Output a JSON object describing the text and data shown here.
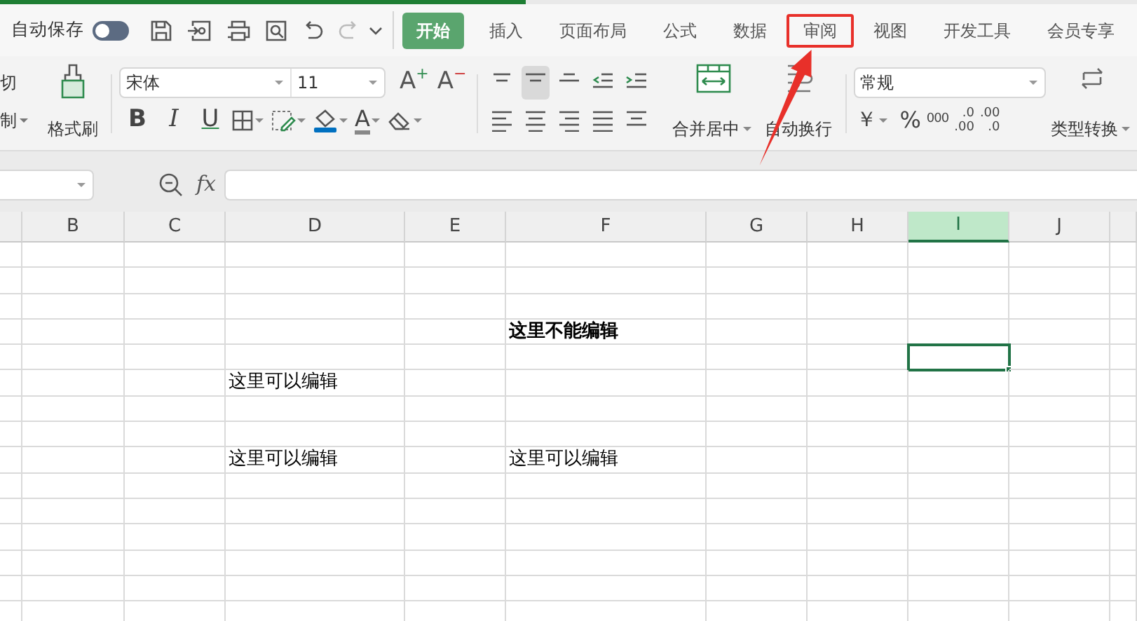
{
  "quick_access": {
    "autosave_label": "自动保存",
    "autosave_on": false
  },
  "tabs": [
    {
      "label": "开始",
      "selected": true,
      "highlighted": false
    },
    {
      "label": "插入",
      "selected": false,
      "highlighted": false
    },
    {
      "label": "页面布局",
      "selected": false,
      "highlighted": false
    },
    {
      "label": "公式",
      "selected": false,
      "highlighted": false
    },
    {
      "label": "数据",
      "selected": false,
      "highlighted": false
    },
    {
      "label": "审阅",
      "selected": false,
      "highlighted": true
    },
    {
      "label": "视图",
      "selected": false,
      "highlighted": false
    },
    {
      "label": "开发工具",
      "selected": false,
      "highlighted": false
    },
    {
      "label": "会员专享",
      "selected": false,
      "highlighted": false
    }
  ],
  "annotation": {
    "arrow": true
  },
  "ribbon": {
    "cut_label": "切",
    "copy_label": "制",
    "format_painter_label": "格式刷",
    "font_name": "宋体",
    "font_size": "11",
    "size_buttons": [
      {
        "letter": "A",
        "sign": "+"
      },
      {
        "letter": "A",
        "sign": "−"
      }
    ],
    "style_buttons": [
      {
        "kind": "bold",
        "label": "B"
      },
      {
        "kind": "italic",
        "label": "I"
      },
      {
        "kind": "underline",
        "label": "U"
      }
    ],
    "font_color_letter": "A",
    "merge_label": "合并居中",
    "wrap_label": "自动换行",
    "number_format": "常规",
    "currency_symbol": "￥",
    "percent_symbol": "%",
    "thousands_label": "000",
    "decimal_buttons": [
      {
        "top": ".0",
        "bottom": ".00"
      },
      {
        "top": ".00",
        "bottom": ".0"
      }
    ],
    "convert_label": "类型转换"
  },
  "formula_bar": {
    "fx_label": "fx"
  },
  "sheet": {
    "columns": [
      {
        "label": "B",
        "selected": false
      },
      {
        "label": "C",
        "selected": false
      },
      {
        "label": "D",
        "selected": false
      },
      {
        "label": "E",
        "selected": false
      },
      {
        "label": "F",
        "selected": false
      },
      {
        "label": "G",
        "selected": false
      },
      {
        "label": "H",
        "selected": false
      },
      {
        "label": "I",
        "selected": true
      },
      {
        "label": "J",
        "selected": false
      }
    ],
    "rows": [
      [
        null,
        null,
        null,
        null,
        null,
        null,
        null,
        null,
        null
      ],
      [
        null,
        null,
        null,
        null,
        null,
        null,
        null,
        null,
        null
      ],
      [
        null,
        null,
        null,
        null,
        null,
        null,
        null,
        null,
        null
      ],
      [
        null,
        null,
        null,
        null,
        {
          "text": "这里不能编辑",
          "bold": true
        },
        null,
        null,
        null,
        null
      ],
      [
        null,
        null,
        null,
        null,
        null,
        null,
        null,
        {
          "selected": true
        },
        null
      ],
      [
        null,
        null,
        {
          "text": "这里可以编辑",
          "bold": false
        },
        null,
        null,
        null,
        null,
        null,
        null
      ],
      [
        null,
        null,
        null,
        null,
        null,
        null,
        null,
        null,
        null
      ],
      [
        null,
        null,
        null,
        null,
        null,
        null,
        null,
        null,
        null
      ],
      [
        null,
        null,
        {
          "text": "这里可以编辑",
          "bold": false
        },
        null,
        {
          "text": "这里可以编辑",
          "bold": false
        },
        null,
        null,
        null,
        null
      ],
      [
        null,
        null,
        null,
        null,
        null,
        null,
        null,
        null,
        null
      ],
      [
        null,
        null,
        null,
        null,
        null,
        null,
        null,
        null,
        null
      ],
      [
        null,
        null,
        null,
        null,
        null,
        null,
        null,
        null,
        null
      ],
      [
        null,
        null,
        null,
        null,
        null,
        null,
        null,
        null,
        null
      ],
      [
        null,
        null,
        null,
        null,
        null,
        null,
        null,
        null,
        null
      ],
      [
        null,
        null,
        null,
        null,
        null,
        null,
        null,
        null,
        null
      ]
    ]
  }
}
